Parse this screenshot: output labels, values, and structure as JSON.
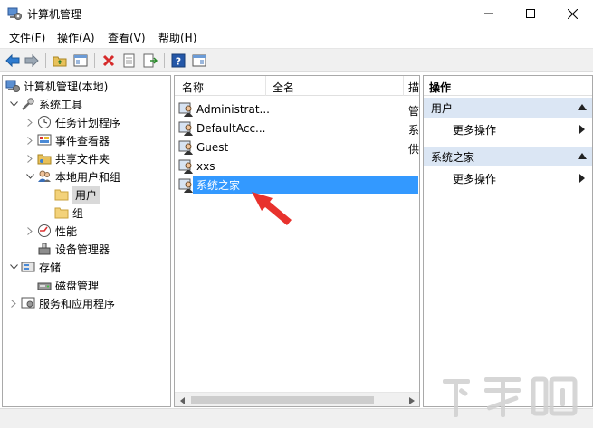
{
  "window": {
    "title": "计算机管理"
  },
  "menu": [
    "文件(F)",
    "操作(A)",
    "查看(V)",
    "帮助(H)"
  ],
  "tree": {
    "root": "计算机管理(本地)",
    "system_tools": "系统工具",
    "task_scheduler": "任务计划程序",
    "event_viewer": "事件查看器",
    "shared_folders": "共享文件夹",
    "local_users_groups": "本地用户和组",
    "users": "用户",
    "groups": "组",
    "performance": "性能",
    "device_manager": "设备管理器",
    "storage": "存储",
    "disk_management": "磁盘管理",
    "services_apps": "服务和应用程序"
  },
  "list": {
    "columns": [
      "名称",
      "全名",
      "描"
    ],
    "rows": [
      {
        "name": "Administrat...",
        "desc": "管"
      },
      {
        "name": "DefaultAcc...",
        "desc": "系"
      },
      {
        "name": "Guest",
        "desc": "供"
      },
      {
        "name": "xxs",
        "desc": ""
      },
      {
        "name": "系统之家",
        "desc": ""
      }
    ]
  },
  "actions": {
    "header": "操作",
    "section1": "用户",
    "more1": "更多操作",
    "section2": "系统之家",
    "more2": "更多操作"
  },
  "watermark": {
    "text": "下载吧"
  },
  "colors": {
    "selection": "#3399ff",
    "section_bg": "#dbe6f4",
    "annotation_arrow": "#e8322d"
  }
}
